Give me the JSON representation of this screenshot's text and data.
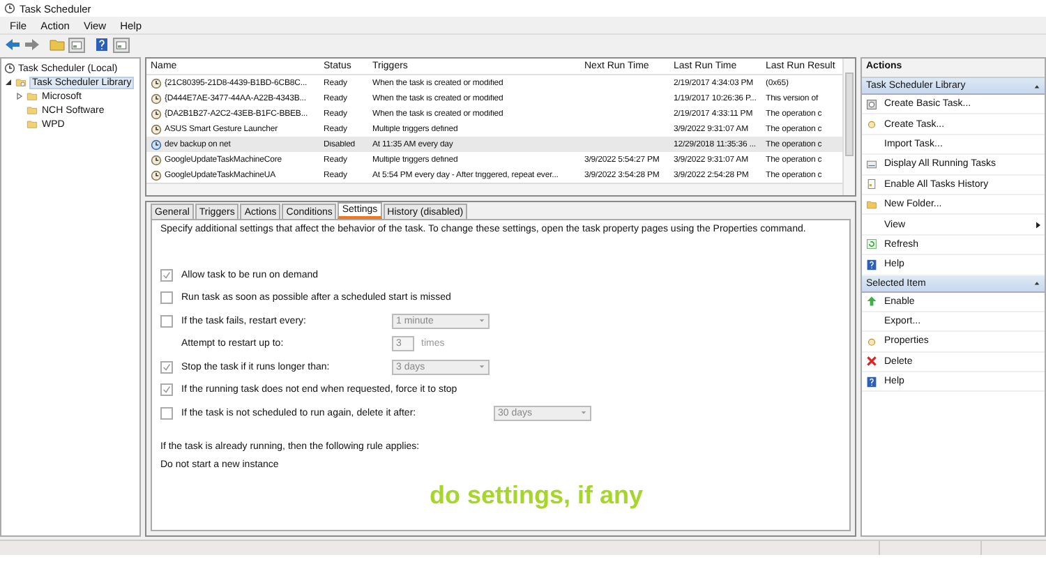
{
  "window": {
    "title": "Task Scheduler"
  },
  "menu": [
    "File",
    "Action",
    "View",
    "Help"
  ],
  "tree": {
    "label": "Task Scheduler (Local)",
    "children": [
      {
        "label": "Task Scheduler Library",
        "selected": true,
        "expanded": true,
        "children": [
          {
            "label": "Microsoft",
            "selected": false,
            "expanded": false
          },
          {
            "label": "NCH Software",
            "selected": false
          },
          {
            "label": "WPD",
            "selected": false
          }
        ]
      }
    ]
  },
  "tasks": {
    "columns": [
      "Name",
      "Status",
      "Triggers",
      "Next Run Time",
      "Last Run Time",
      "Last Run Result"
    ],
    "rows": [
      {
        "selected": false,
        "cells": [
          "{21C80395-21D8-4439-B1BD-6CB8C...",
          "Ready",
          "When the task is created or modified",
          "",
          "2/19/2017 4:34:03 PM",
          "(0x65)"
        ]
      },
      {
        "selected": false,
        "cells": [
          "{D444E7AE-3477-44AA-A22B-4343B...",
          "Ready",
          "When the task is created or modified",
          "",
          "1/19/2017 10:26:36 P...",
          "This version of"
        ]
      },
      {
        "selected": false,
        "cells": [
          "{DA2B1B27-A2C2-43EB-B1FC-BBEB...",
          "Ready",
          "When the task is created or modified",
          "",
          "2/19/2017 4:33:11 PM",
          "The operation c"
        ]
      },
      {
        "selected": false,
        "cells": [
          "ASUS Smart Gesture Launcher",
          "Ready",
          "Multiple triggers defined",
          "",
          "3/9/2022 9:31:07 AM",
          "The operation c"
        ]
      },
      {
        "selected": true,
        "cells": [
          "dev backup on net",
          "Disabled",
          "At 11:35 AM every day",
          "",
          "12/29/2018 11:35:36 ...",
          "The operation c"
        ]
      },
      {
        "selected": false,
        "cells": [
          "GoogleUpdateTaskMachineCore",
          "Ready",
          "Multiple triggers defined",
          "3/9/2022 5:54:27 PM",
          "3/9/2022 9:31:07 AM",
          "The operation c"
        ]
      },
      {
        "selected": false,
        "cells": [
          "GoogleUpdateTaskMachineUA",
          "Ready",
          "At 5:54 PM every day - After triggered, repeat ever...",
          "3/9/2022 3:54:28 PM",
          "3/9/2022 2:54:28 PM",
          "The operation c"
        ]
      }
    ]
  },
  "detail_tabs": [
    {
      "label": "General",
      "selected": false
    },
    {
      "label": "Triggers",
      "selected": false
    },
    {
      "label": "Actions",
      "selected": false
    },
    {
      "label": "Conditions",
      "selected": false
    },
    {
      "label": "Settings",
      "selected": true
    },
    {
      "label": "History (disabled)",
      "selected": false
    }
  ],
  "description": "Specify additional settings that affect the behavior of the task. To change these settings, open the task property pages using the Properties command.",
  "settings": [
    {
      "kind": "checkbox",
      "label": "Allow task to be run on demand",
      "checked": true
    },
    {
      "kind": "checkbox",
      "label": "Run task as soon as possible after a scheduled start is missed",
      "checked": false
    },
    {
      "kind": "checkbox",
      "label": "If the task fails, restart every:",
      "checked": false,
      "control": {
        "kind": "dropdown",
        "value": "1 minute"
      }
    },
    {
      "kind": "text",
      "label": "Attempt to restart up to:",
      "control": {
        "kind": "spin",
        "value": "3",
        "suffix": "times"
      }
    },
    {
      "kind": "checkbox",
      "label": "Stop the task if it runs longer than:",
      "checked": true,
      "control": {
        "kind": "dropdown",
        "value": "3 days"
      }
    },
    {
      "kind": "checkbox",
      "label": "If the running task does not end when requested, force it to stop",
      "checked": true
    },
    {
      "kind": "checkbox",
      "label": "If the task is not scheduled to run again, delete it after:",
      "checked": false,
      "control": {
        "kind": "wide-dropdown",
        "value": "30 days"
      }
    }
  ],
  "rule_label": "If the task is already running, then the following rule applies:",
  "rule_value": "Do not start a new instance",
  "annotation": "do settings, if any",
  "actions": {
    "title": "Actions",
    "sections": [
      {
        "title": "Task Scheduler Library",
        "items": [
          {
            "label": "Create Basic Task..."
          },
          {
            "label": "Create Task..."
          },
          {
            "label": "Import Task..."
          },
          {
            "label": "Display All Running Tasks"
          },
          {
            "label": "Enable All Tasks History"
          },
          {
            "label": "New Folder..."
          },
          {
            "label": "View",
            "submenu": true
          },
          {
            "label": "Refresh"
          },
          {
            "label": "Help"
          }
        ]
      },
      {
        "title": "Selected Item",
        "items": [
          {
            "label": "Enable"
          },
          {
            "label": "Export..."
          },
          {
            "label": "Properties"
          },
          {
            "label": "Delete"
          },
          {
            "label": "Help"
          }
        ]
      }
    ]
  }
}
